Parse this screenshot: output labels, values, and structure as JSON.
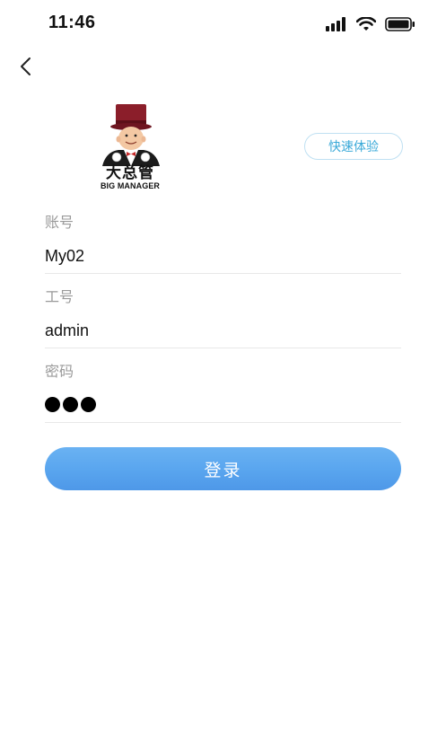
{
  "status_bar": {
    "time": "11:46",
    "icons": [
      "signal-icon",
      "wifi-icon",
      "battery-icon"
    ]
  },
  "nav": {
    "back_icon": "chevron-left-icon"
  },
  "logo": {
    "name_cn": "大总管",
    "name_en": "BIG MANAGER"
  },
  "quick_experience_label": "快速体验",
  "form": {
    "account_label": "账号",
    "account_value": "My02",
    "employee_id_label": "工号",
    "employee_id_value": "admin",
    "password_label": "密码",
    "password_mask_length": 3
  },
  "login_label": "登录",
  "colors": {
    "accent": "#5aa6ef",
    "quick_button_text": "#3aa9d8",
    "label_gray": "#9a9a9a",
    "hat": "#8b1e2a"
  }
}
